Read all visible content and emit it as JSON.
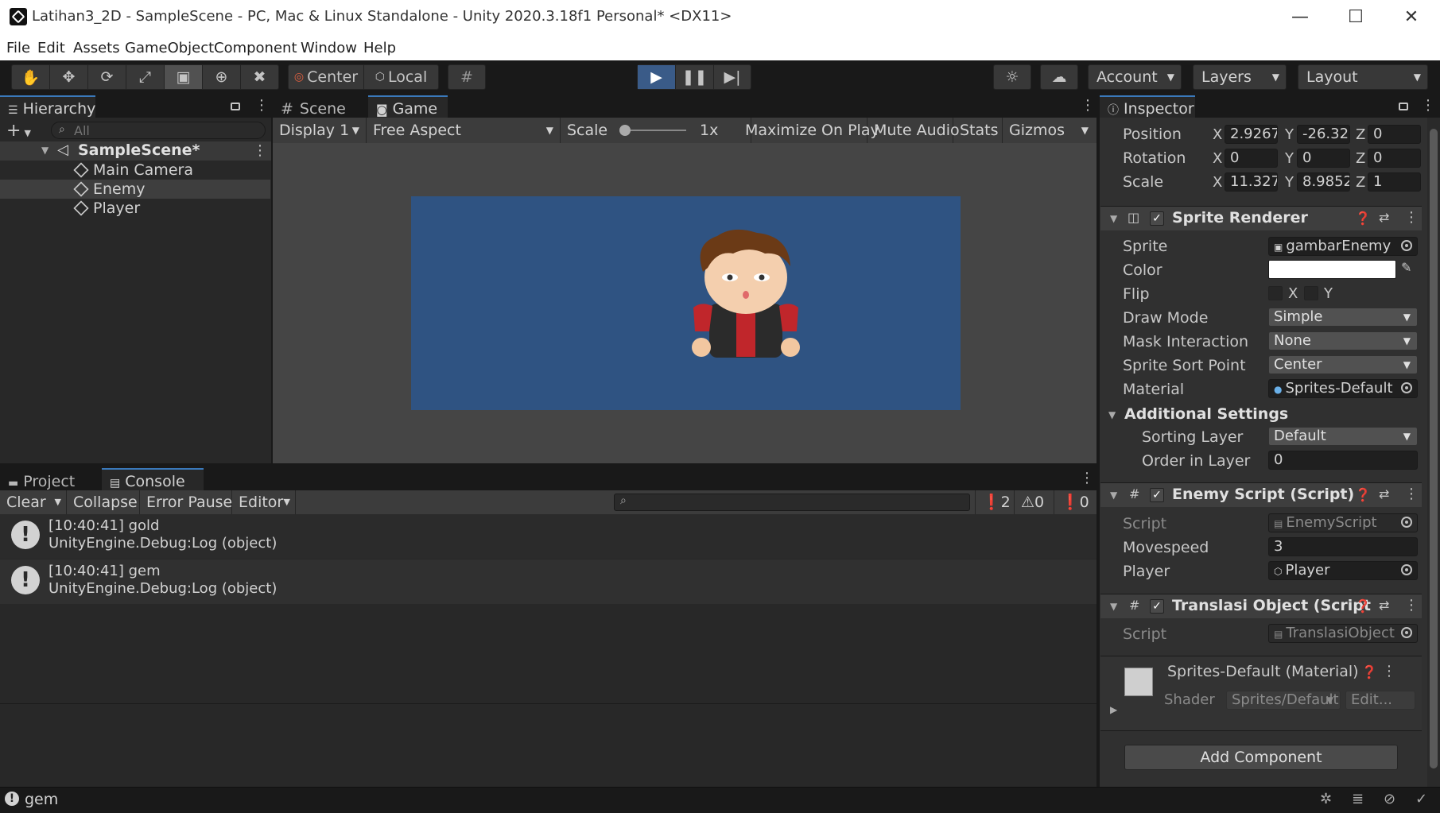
{
  "window": {
    "title": "Latihan3_2D - SampleScene - PC, Mac & Linux Standalone - Unity 2020.3.18f1 Personal* <DX11>",
    "minimize": "—",
    "maximize": "☐",
    "close": "✕"
  },
  "menu": [
    "File",
    "Edit",
    "Assets",
    "GameObject",
    "Component",
    "Window",
    "Help"
  ],
  "toolbar": {
    "pivot": "Center",
    "space": "Local",
    "account": "Account",
    "layers": "Layers",
    "layout": "Layout"
  },
  "hierarchy": {
    "tab": "Hierarchy",
    "search_placeholder": "All",
    "scene": "SampleScene*",
    "items": [
      "Main Camera",
      "Enemy",
      "Player"
    ],
    "selected": "Enemy"
  },
  "game": {
    "tabs": [
      "Scene",
      "Game"
    ],
    "display": "Display 1",
    "aspect": "Free Aspect",
    "scale_label": "Scale",
    "scale_value": "1x",
    "buttons": [
      "Maximize On Play",
      "Mute Audio",
      "Stats",
      "Gizmos"
    ],
    "background_color": "#2f5382"
  },
  "console": {
    "tabs": [
      "Project",
      "Console"
    ],
    "clear": "Clear",
    "collapse": "Collapse",
    "error_pause": "Error Pause",
    "editor": "Editor",
    "counts": {
      "log": "2",
      "warn": "0",
      "error": "0"
    },
    "entries": [
      {
        "line1": "[10:40:41] gold",
        "line2": "UnityEngine.Debug:Log (object)"
      },
      {
        "line1": "[10:40:41] gem",
        "line2": "UnityEngine.Debug:Log (object)"
      }
    ]
  },
  "inspector": {
    "tab": "Inspector",
    "transform": {
      "position": {
        "label": "Position",
        "x": "2.9267",
        "y": "-26.32",
        "z": "0"
      },
      "rotation": {
        "label": "Rotation",
        "x": "0",
        "y": "0",
        "z": "0"
      },
      "scale": {
        "label": "Scale",
        "x": "11.327",
        "y": "8.9852",
        "z": "1"
      }
    },
    "sprite_renderer": {
      "title": "Sprite Renderer",
      "sprite_label": "Sprite",
      "sprite": "gambarEnemy",
      "color_label": "Color",
      "color": "#ffffff",
      "flip_label": "Flip",
      "flip_x": "X",
      "flip_y": "Y",
      "draw_mode_label": "Draw Mode",
      "draw_mode": "Simple",
      "mask_label": "Mask Interaction",
      "mask": "None",
      "sort_point_label": "Sprite Sort Point",
      "sort_point": "Center",
      "material_label": "Material",
      "material": "Sprites-Default",
      "additional": "Additional Settings",
      "sorting_layer_label": "Sorting Layer",
      "sorting_layer": "Default",
      "order_label": "Order in Layer",
      "order": "0"
    },
    "enemy_script": {
      "title": "Enemy Script (Script)",
      "script_label": "Script",
      "script": "EnemyScript",
      "movespeed_label": "Movespeed",
      "movespeed": "3",
      "player_label": "Player",
      "player": "Player"
    },
    "translasi": {
      "title": "Translasi Object (Script",
      "script_label": "Script",
      "script": "TranslasiObject"
    },
    "material": {
      "title": "Sprites-Default (Material)",
      "shader_label": "Shader",
      "shader": "Sprites/Default",
      "edit": "Edit..."
    },
    "add_component": "Add Component"
  },
  "status": {
    "message": "gem"
  }
}
